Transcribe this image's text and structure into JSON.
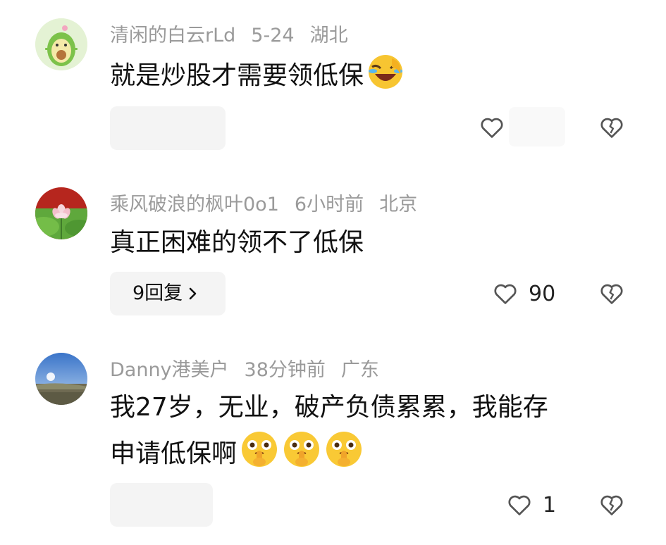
{
  "comments": [
    {
      "user": "清闲的白云rLd",
      "time": "5-24",
      "location": "湖北",
      "text": "就是炒股才需要领低保",
      "emoji": [
        "laugh-cry-face-icon"
      ],
      "reply_label": "",
      "likes": ""
    },
    {
      "user": "乘风破浪的枫叶0o1",
      "time": "6小时前",
      "location": "北京",
      "text": "真正困难的领不了低保",
      "emoji": [],
      "reply_label": "9回复",
      "likes": "90"
    },
    {
      "user": "Danny港美户",
      "time": "38分钟前",
      "location": "广东",
      "text_line1": "我27岁，无业，破产负债累累，我能存",
      "text_line2": "申请低保啊",
      "emoji": [
        "shush-face-icon",
        "shush-face-icon",
        "shush-face-icon"
      ],
      "reply_label": "",
      "likes": "1"
    }
  ],
  "colors": {
    "meta": "#9a9a9a",
    "text": "#111111",
    "pill": "#f4f4f4",
    "icon": "#555555"
  }
}
